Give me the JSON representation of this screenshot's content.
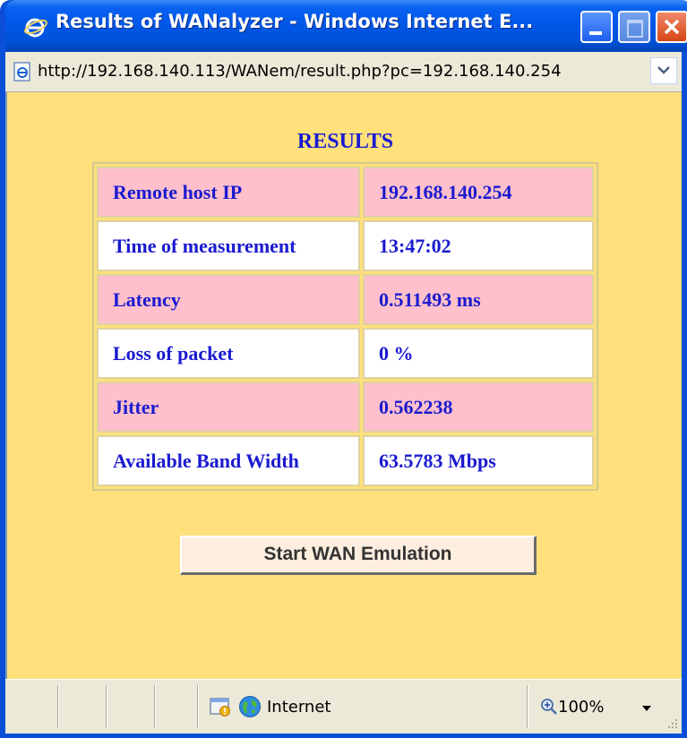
{
  "window": {
    "title": "Results of WANalyzer - Windows Internet E..."
  },
  "address": {
    "url": "http://192.168.140.113/WANem/result.php?pc=192.168.140.254"
  },
  "results": {
    "heading": "RESULTS",
    "rows": [
      {
        "label": "Remote host IP",
        "value": "192.168.140.254"
      },
      {
        "label": "Time of measurement",
        "value": "13:47:02"
      },
      {
        "label": "Latency",
        "value": "0.511493 ms"
      },
      {
        "label": "Loss of packet",
        "value": "0 %"
      },
      {
        "label": "Jitter",
        "value": "0.562238"
      },
      {
        "label": "Available Band Width",
        "value": "63.5783 Mbps"
      }
    ],
    "button_label": "Start WAN Emulation"
  },
  "statusbar": {
    "zone": "Internet",
    "zoom": "100%"
  },
  "icons": {
    "title": "ie-logo-icon",
    "address": "page-icon",
    "zone": "protected-mode-warning-icon",
    "globe": "globe-icon",
    "zoom": "zoom-icon"
  },
  "colors": {
    "page_background": "#ffe07a",
    "row_highlight": "#ffc0cb",
    "text": "#1a1ad0"
  }
}
